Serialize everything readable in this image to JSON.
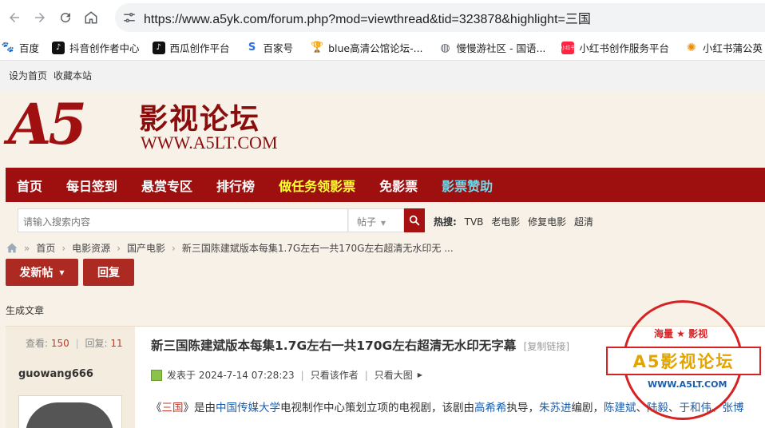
{
  "browser": {
    "url": "https://www.a5yk.com/forum.php?mod=viewthread&tid=323878&highlight=三国",
    "bookmarks": [
      {
        "label": "百度",
        "icon": "baidu-icon"
      },
      {
        "label": "抖音创作者中心",
        "icon": "douyin-icon"
      },
      {
        "label": "西瓜创作平台",
        "icon": "douyin-icon"
      },
      {
        "label": "百家号",
        "icon": "baijiahao-icon"
      },
      {
        "label": "blue高清公馆论坛-...",
        "icon": "trophy-icon"
      },
      {
        "label": "慢慢游社区 - 国语...",
        "icon": "globe-icon"
      },
      {
        "label": "小红书创作服务平台",
        "icon": "xiaohongshu-icon"
      },
      {
        "label": "小红书蒲公英",
        "icon": "dandelion-icon"
      }
    ]
  },
  "site": {
    "top_links": [
      "设为首页",
      "收藏本站"
    ],
    "logo": {
      "mark": "A5",
      "name": "影视论坛",
      "url": "WWW.A5LT.COM"
    },
    "nav": [
      {
        "label": "首页",
        "color": "#ffffff"
      },
      {
        "label": "每日签到",
        "color": "#ffffff"
      },
      {
        "label": "悬赏专区",
        "color": "#ffffff"
      },
      {
        "label": "排行榜",
        "color": "#ffffff"
      },
      {
        "label": "做任务领影票",
        "color": "#ffff33"
      },
      {
        "label": "免影票",
        "color": "#ffffff"
      },
      {
        "label": "影票赞助",
        "color": "#66ddee"
      }
    ],
    "search": {
      "placeholder": "请输入搜索内容",
      "type": "帖子",
      "hot_label": "热搜:",
      "hot": [
        "TVB",
        "老电影",
        "修复电影",
        "超清"
      ]
    },
    "breadcrumb": [
      "首页",
      "电影资源",
      "国产电影",
      "新三国陈建斌版本每集1.7G左右一共170G左右超清无水印无 ..."
    ],
    "buttons": {
      "new_post": "发新帖",
      "reply": "回复"
    },
    "gen_article": "生成文章"
  },
  "post": {
    "views_label": "查看:",
    "views": "150",
    "replies_label": "回复:",
    "replies": "11",
    "author": "guowang666",
    "title": "新三国陈建斌版本每集1.7G左右一共170G左右超清无水印无字幕",
    "copy_link": "[复制链接]",
    "posted": "发表于 2024-7-14 07:28:23",
    "only_author": "只看该作者",
    "only_big_images": "只看大图",
    "body": [
      {
        "t": "《",
        "c": ""
      },
      {
        "t": "三国",
        "c": "lkr"
      },
      {
        "t": "》是由",
        "c": ""
      },
      {
        "t": "中国传媒大学",
        "c": "lk"
      },
      {
        "t": "电视制作中心策划立项的电视剧，该剧由",
        "c": ""
      },
      {
        "t": "高希希",
        "c": "lk"
      },
      {
        "t": "执导，",
        "c": ""
      },
      {
        "t": "朱苏进",
        "c": "lk"
      },
      {
        "t": "编剧，",
        "c": ""
      },
      {
        "t": "陈建斌",
        "c": "lk"
      },
      {
        "t": "、",
        "c": ""
      },
      {
        "t": "陆毅",
        "c": "lk"
      },
      {
        "t": "、",
        "c": ""
      },
      {
        "t": "于和伟",
        "c": "lk"
      },
      {
        "t": "、",
        "c": ""
      },
      {
        "t": "张博",
        "c": "lk"
      }
    ]
  },
  "watermark": {
    "top": "海量 ★ 影视",
    "main": "A5影视论坛",
    "url": "WWW.A5LT.COM"
  }
}
